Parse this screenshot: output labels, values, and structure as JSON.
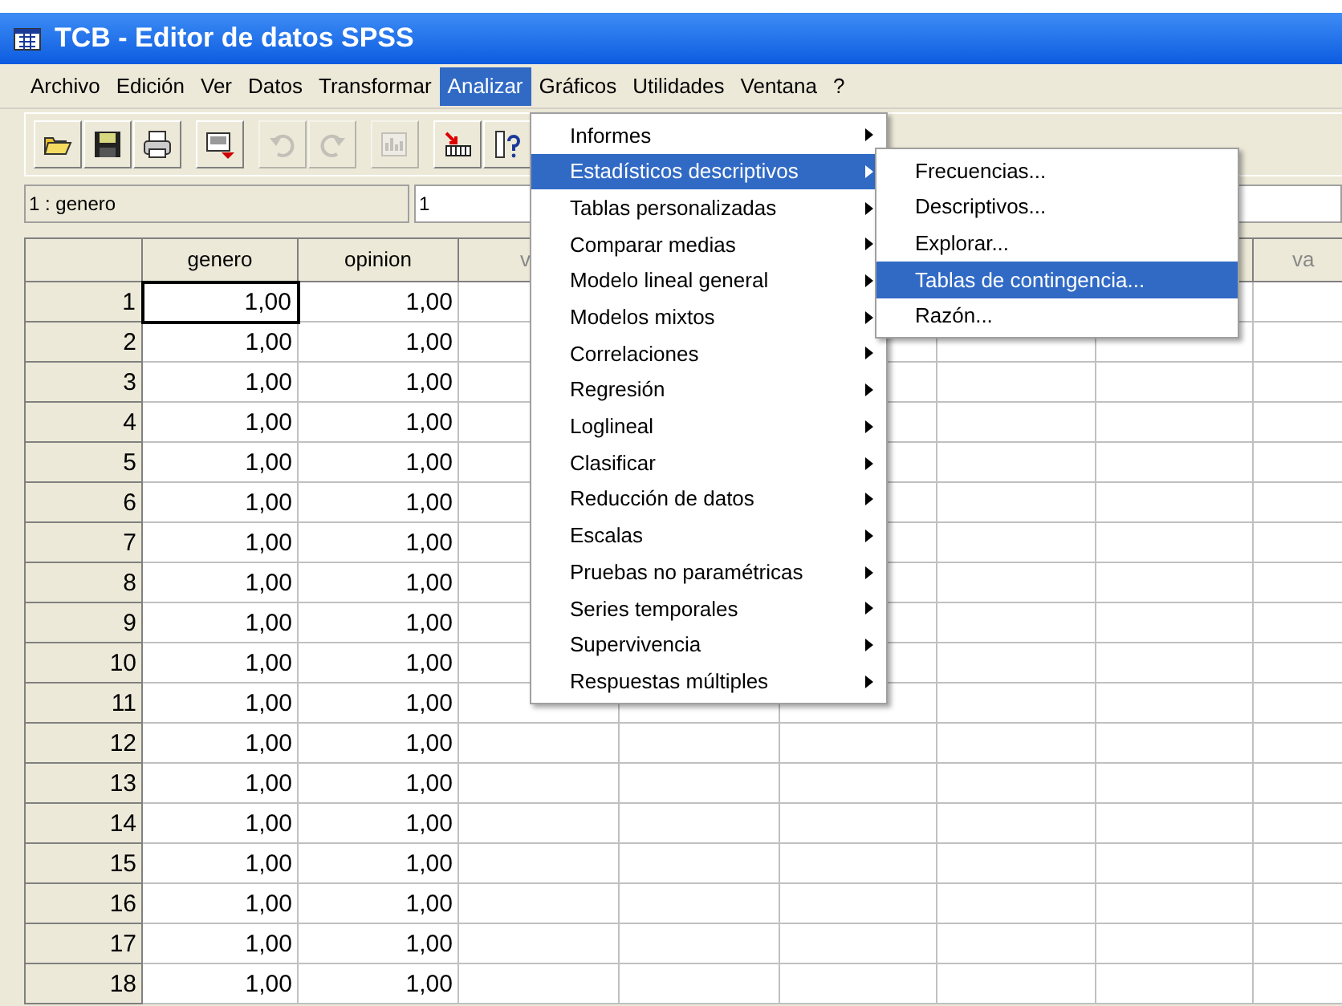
{
  "window": {
    "title": "TCB - Editor de datos SPSS"
  },
  "menu_bar": [
    {
      "label": "Archivo",
      "selected": false
    },
    {
      "label": "Edición",
      "selected": false
    },
    {
      "label": "Ver",
      "selected": false
    },
    {
      "label": "Datos",
      "selected": false
    },
    {
      "label": "Transformar",
      "selected": false
    },
    {
      "label": "Analizar",
      "selected": true
    },
    {
      "label": "Gráficos",
      "selected": false
    },
    {
      "label": "Utilidades",
      "selected": false
    },
    {
      "label": "Ventana",
      "selected": false
    },
    {
      "label": "?",
      "selected": false
    }
  ],
  "toolbar": [
    {
      "kind": "open",
      "disabled": false
    },
    {
      "kind": "save",
      "disabled": false
    },
    {
      "kind": "print",
      "disabled": false
    },
    {
      "kind": "dialog",
      "disabled": false
    },
    {
      "kind": "undo",
      "disabled": true
    },
    {
      "kind": "redo",
      "disabled": true
    },
    {
      "kind": "chart",
      "disabled": true
    },
    {
      "kind": "goto",
      "disabled": false
    },
    {
      "kind": "variables",
      "disabled": false
    }
  ],
  "cell_editor": {
    "cell": "1 : genero",
    "value": "1"
  },
  "grid": {
    "columns": [
      "genero",
      "opinion",
      "v",
      "",
      "",
      "",
      "",
      "va"
    ],
    "rows": [
      {
        "number": "1",
        "genero": "1,00",
        "opinion": "1,00",
        "selected": true
      },
      {
        "number": "2",
        "genero": "1,00",
        "opinion": "1,00",
        "selected": false
      },
      {
        "number": "3",
        "genero": "1,00",
        "opinion": "1,00",
        "selected": false
      },
      {
        "number": "4",
        "genero": "1,00",
        "opinion": "1,00",
        "selected": false
      },
      {
        "number": "5",
        "genero": "1,00",
        "opinion": "1,00",
        "selected": false
      },
      {
        "number": "6",
        "genero": "1,00",
        "opinion": "1,00",
        "selected": false
      },
      {
        "number": "7",
        "genero": "1,00",
        "opinion": "1,00",
        "selected": false
      },
      {
        "number": "8",
        "genero": "1,00",
        "opinion": "1,00",
        "selected": false
      },
      {
        "number": "9",
        "genero": "1,00",
        "opinion": "1,00",
        "selected": false
      },
      {
        "number": "10",
        "genero": "1,00",
        "opinion": "1,00",
        "selected": false
      },
      {
        "number": "11",
        "genero": "1,00",
        "opinion": "1,00",
        "selected": false
      },
      {
        "number": "12",
        "genero": "1,00",
        "opinion": "1,00",
        "selected": false
      },
      {
        "number": "13",
        "genero": "1,00",
        "opinion": "1,00",
        "selected": false
      },
      {
        "number": "14",
        "genero": "1,00",
        "opinion": "1,00",
        "selected": false
      },
      {
        "number": "15",
        "genero": "1,00",
        "opinion": "1,00",
        "selected": false
      },
      {
        "number": "16",
        "genero": "1,00",
        "opinion": "1,00",
        "selected": false
      },
      {
        "number": "17",
        "genero": "1,00",
        "opinion": "1,00",
        "selected": false
      },
      {
        "number": "18",
        "genero": "1,00",
        "opinion": "1,00",
        "selected": false
      }
    ]
  },
  "analizar_menu": [
    {
      "label": "Informes",
      "selected": false
    },
    {
      "label": "Estadísticos descriptivos",
      "selected": true
    },
    {
      "label": "Tablas personalizadas",
      "selected": false
    },
    {
      "label": "Comparar medias",
      "selected": false
    },
    {
      "label": "Modelo lineal general",
      "selected": false
    },
    {
      "label": "Modelos mixtos",
      "selected": false
    },
    {
      "label": "Correlaciones",
      "selected": false
    },
    {
      "label": "Regresión",
      "selected": false
    },
    {
      "label": "Loglineal",
      "selected": false
    },
    {
      "label": "Clasificar",
      "selected": false
    },
    {
      "label": "Reducción de datos",
      "selected": false
    },
    {
      "label": "Escalas",
      "selected": false
    },
    {
      "label": "Pruebas no paramétricas",
      "selected": false
    },
    {
      "label": "Series temporales",
      "selected": false
    },
    {
      "label": "Supervivencia",
      "selected": false
    },
    {
      "label": "Respuestas múltiples",
      "selected": false
    }
  ],
  "submenu": [
    {
      "label": "Frecuencias...",
      "selected": false
    },
    {
      "label": "Descriptivos...",
      "selected": false
    },
    {
      "label": "Explorar...",
      "selected": false
    },
    {
      "label": "Tablas de contingencia...",
      "selected": true
    },
    {
      "label": "Razón...",
      "selected": false
    }
  ]
}
